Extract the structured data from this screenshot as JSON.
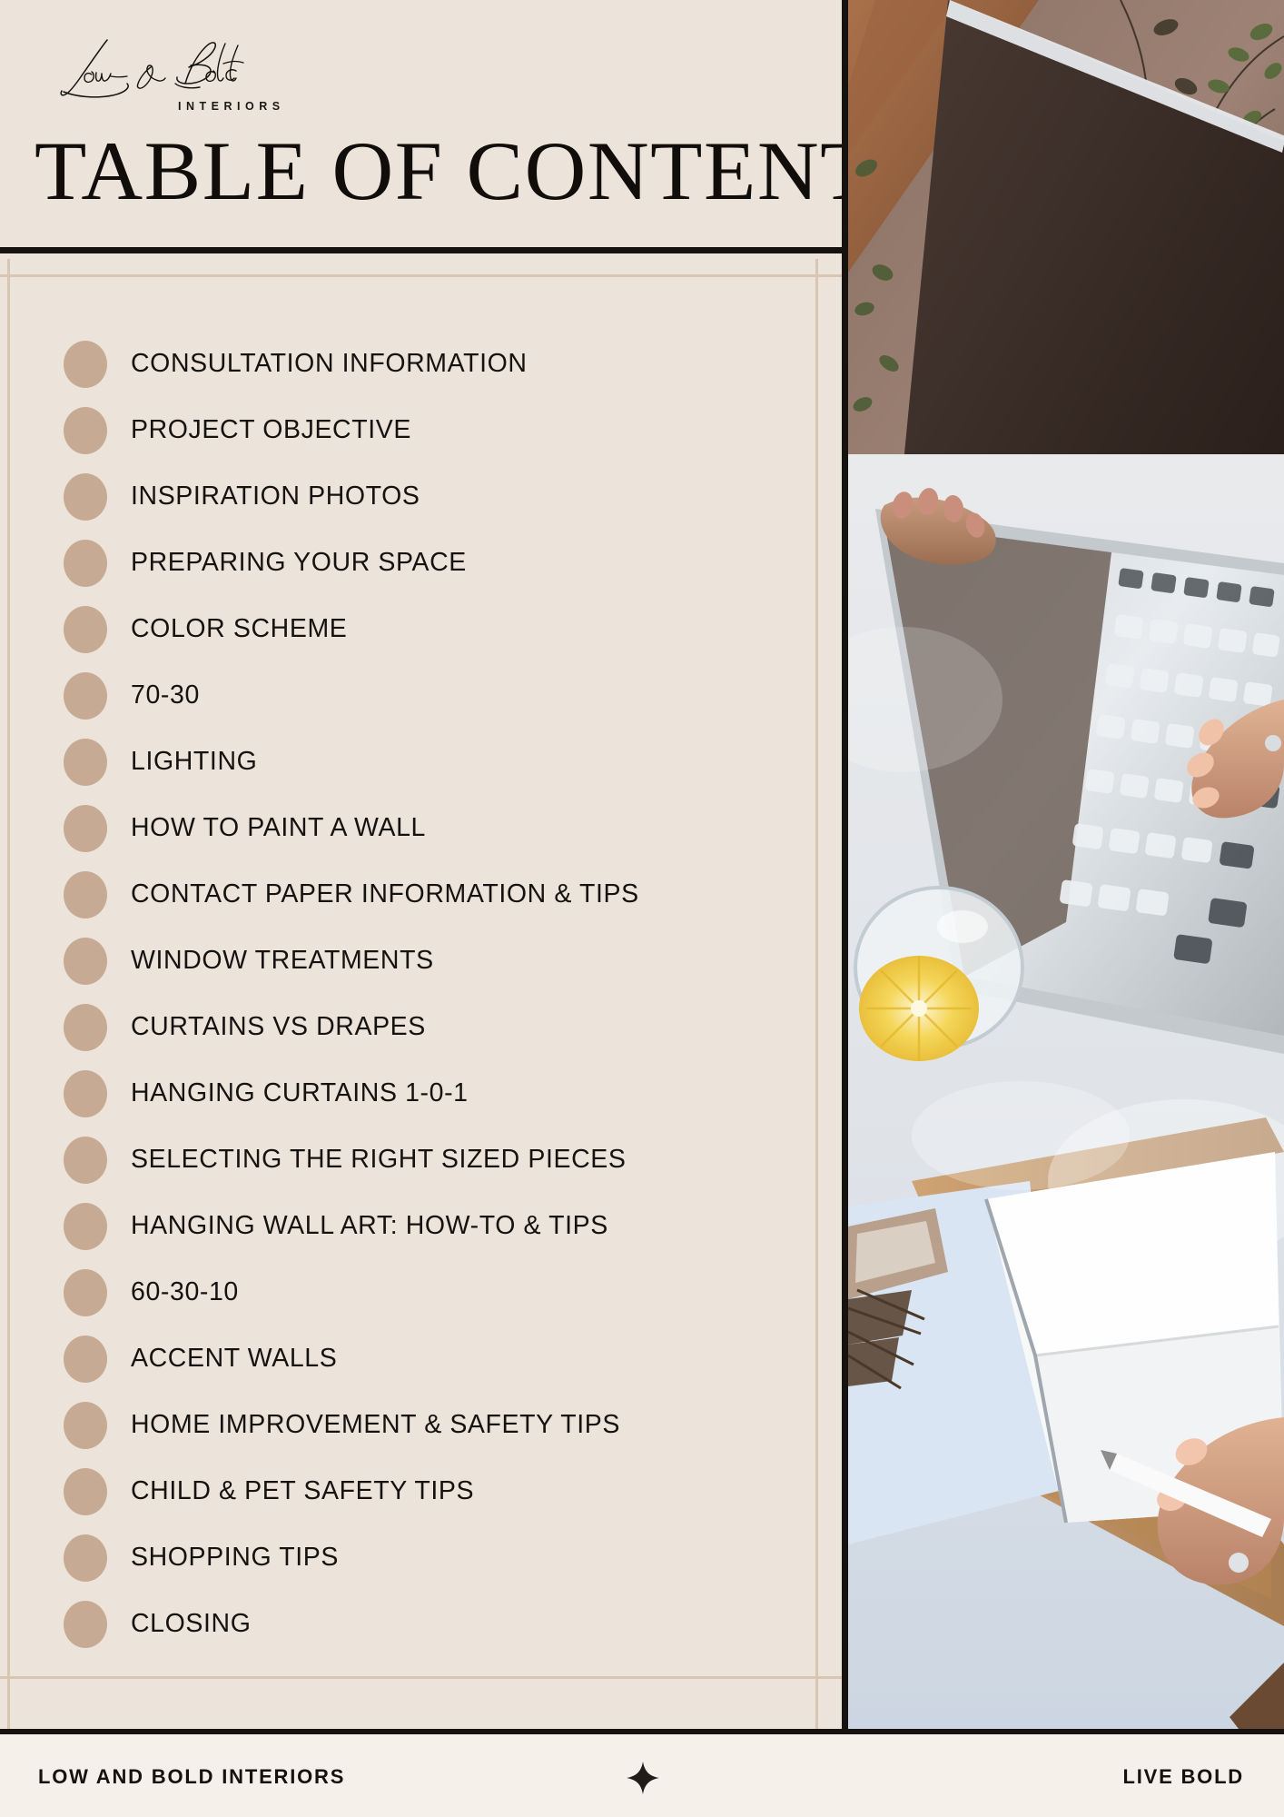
{
  "document": {
    "title": "TABLE OF CONTENTS",
    "brand": {
      "script_name": "Low & Bold",
      "subtitle": "INTERIORS",
      "logo_icon": "script-signature-logo"
    }
  },
  "contents": {
    "items": [
      {
        "label": "CONSULTATION INFORMATION"
      },
      {
        "label": "PROJECT OBJECTIVE"
      },
      {
        "label": "INSPIRATION PHOTOS"
      },
      {
        "label": "PREPARING YOUR SPACE"
      },
      {
        "label": "COLOR SCHEME"
      },
      {
        "label": "70-30"
      },
      {
        "label": "LIGHTING"
      },
      {
        "label": "HOW TO PAINT A WALL"
      },
      {
        "label": "CONTACT PAPER INFORMATION & TIPS"
      },
      {
        "label": "WINDOW TREATMENTS"
      },
      {
        "label": "CURTAINS VS DRAPES"
      },
      {
        "label": "HANGING CURTAINS 1-0-1"
      },
      {
        "label": "SELECTING THE RIGHT SIZED PIECES"
      },
      {
        "label": "HANGING WALL ART: HOW-TO & TIPS"
      },
      {
        "label": "60-30-10"
      },
      {
        "label": "ACCENT WALLS"
      },
      {
        "label": "HOME IMPROVEMENT & SAFETY TIPS"
      },
      {
        "label": "CHILD & PET SAFETY TIPS"
      },
      {
        "label": "SHOPPING TIPS"
      },
      {
        "label": "CLOSING"
      }
    ]
  },
  "photo": {
    "alt_name": "laptop-desk-photo",
    "description": "Overhead photo of hands typing on a laptop with lemon water, notebook and pencil"
  },
  "footer": {
    "left_text": "LOW AND BOLD INTERIORS",
    "center_icon": "sparkle-star-icon",
    "right_text": "LIVE BOLD"
  },
  "colors": {
    "page_background": "#f5f1ea",
    "panel_background": "#ece4da",
    "bullet": "#c7aa93",
    "rule_tan": "#d9c6b2",
    "ink": "#15120f"
  }
}
